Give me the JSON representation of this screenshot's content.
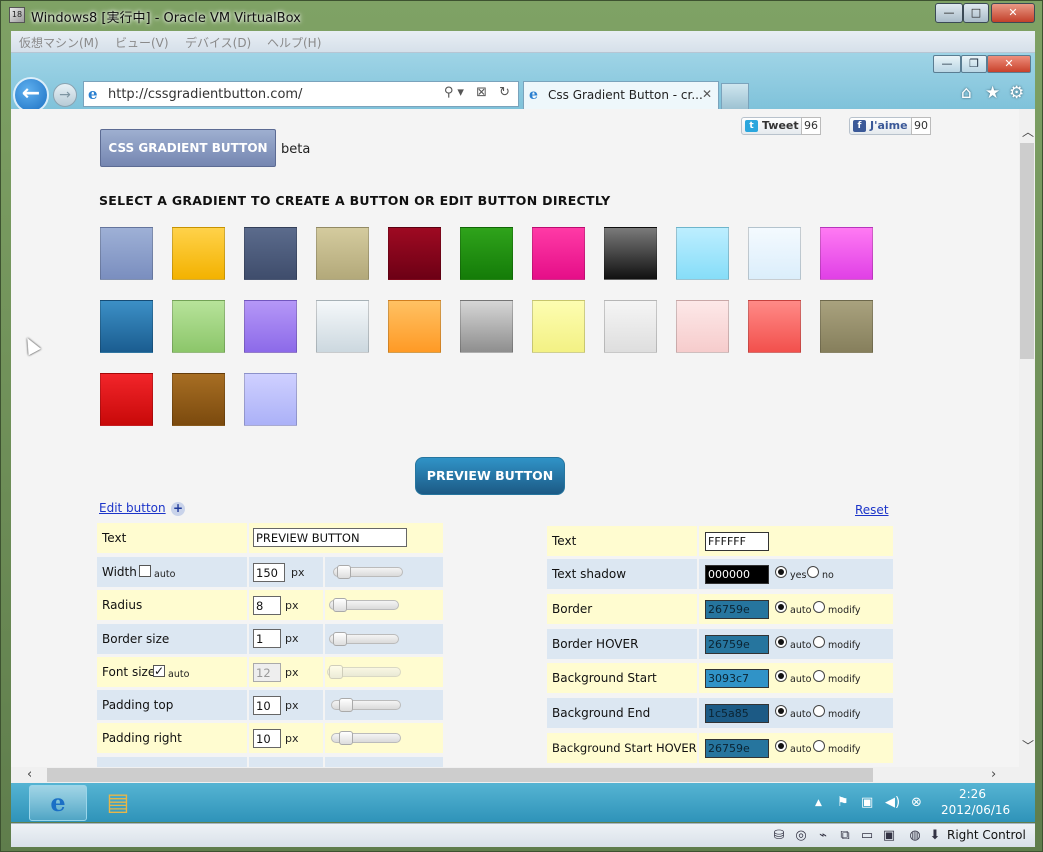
{
  "vbox": {
    "title": "Windows8 [実行中] - Oracle VM VirtualBox",
    "app_icon_text": "18",
    "controls": {
      "minimize": "—",
      "maximize": "□",
      "close": "✕"
    },
    "menu": [
      "仮想マシン(M)",
      "ビュー(V)",
      "デバイス(D)",
      "ヘルプ(H)"
    ],
    "status_host_key": "Right Control"
  },
  "ie": {
    "address": "http://cssgradientbutton.com/",
    "address_icons": "⚲▾ ⊠ ↻",
    "tab_label": "Css Gradient Button - cr...",
    "tab_close": "✕",
    "window_controls": {
      "minimize": "—",
      "restore": "❐",
      "close": "✕"
    },
    "right_icons": {
      "home": "⌂",
      "favorites": "★",
      "tools": "⚙"
    }
  },
  "page": {
    "logo_button": "CSS GRADIENT BUTTON",
    "logo_beta": "beta",
    "tweet": {
      "label": "Tweet",
      "count": "96"
    },
    "like": {
      "label": "J'aime",
      "count": "90"
    },
    "section_heading": "SELECT A GRADIENT TO CREATE A BUTTON OR EDIT BUTTON DIRECTLY",
    "swatches": [
      {
        "top": "#9eb0d6",
        "bottom": "#7a8ebf"
      },
      {
        "top": "#ffd24a",
        "bottom": "#f3b200"
      },
      {
        "top": "#5b6b8c",
        "bottom": "#3f4d6c"
      },
      {
        "top": "#d4cb9e",
        "bottom": "#b3a97a"
      },
      {
        "top": "#9e0a22",
        "bottom": "#6d0015"
      },
      {
        "top": "#2fa31b",
        "bottom": "#147c08"
      },
      {
        "top": "#ff3aa6",
        "bottom": "#e50e88"
      },
      {
        "top": "#7a7a7a",
        "bottom": "#111111"
      },
      {
        "top": "#bdeeff",
        "bottom": "#86ddf8"
      },
      {
        "top": "#f4faff",
        "bottom": "#dbeefb"
      },
      {
        "top": "#ff7af3",
        "bottom": "#e040e6"
      },
      {
        "top": "#3c90c6",
        "bottom": "#1a5d90"
      },
      {
        "top": "#b7e39a",
        "bottom": "#8cc66a"
      },
      {
        "top": "#b597f7",
        "bottom": "#8c6ae9"
      },
      {
        "top": "#f5f8fa",
        "bottom": "#ccd8df"
      },
      {
        "top": "#ffc163",
        "bottom": "#ff9a25"
      },
      {
        "top": "#d6d6d6",
        "bottom": "#8e8e8e"
      },
      {
        "top": "#fdfdb1",
        "bottom": "#f3f184"
      },
      {
        "top": "#f5f5f5",
        "bottom": "#dedede"
      },
      {
        "top": "#fde8e8",
        "bottom": "#f6cccc"
      },
      {
        "top": "#ff8a87",
        "bottom": "#f2504c"
      },
      {
        "top": "#a9a27e",
        "bottom": "#867f5c"
      },
      {
        "top": "#f2252a",
        "bottom": "#c80909"
      },
      {
        "top": "#a76e23",
        "bottom": "#7b4a0e"
      },
      {
        "top": "#cfd0ff",
        "bottom": "#abb1f7"
      }
    ],
    "preview_label": "PREVIEW BUTTON",
    "edit_link": "Edit button",
    "edit_plus": "+",
    "reset_link": "Reset",
    "left_rows": [
      {
        "label": "Text",
        "value": "PREVIEW BUTTON"
      },
      {
        "label": "Width",
        "value": "150",
        "unit": "px",
        "auto_label": "auto",
        "auto_checked": false,
        "slider": 0.05
      },
      {
        "label": "Radius",
        "value": "8",
        "unit": "px",
        "slider": 0.05
      },
      {
        "label": "Border size",
        "value": "1",
        "unit": "px",
        "slider": 0.05
      },
      {
        "label": "Font size",
        "value": "12",
        "unit": "px",
        "auto_label": "auto",
        "auto_checked": true,
        "slider": 0.02
      },
      {
        "label": "Padding top",
        "value": "10",
        "unit": "px",
        "slider": 0.12
      },
      {
        "label": "Padding right",
        "value": "10",
        "unit": "px",
        "slider": 0.12
      }
    ],
    "right_rows": [
      {
        "label": "Text",
        "value": "FFFFFF",
        "swatch": "#ffffff"
      },
      {
        "label": "Text shadow",
        "value": "000000",
        "swatch": "#000000",
        "opt1": "yes",
        "opt2": "no"
      },
      {
        "label": "Border",
        "value": "26759e",
        "swatch": "#26759e",
        "opt1": "auto",
        "opt2": "modify"
      },
      {
        "label": "Border HOVER",
        "value": "26759e",
        "swatch": "#26759e",
        "opt1": "auto",
        "opt2": "modify"
      },
      {
        "label": "Background Start",
        "value": "3093c7",
        "swatch": "#3093c7",
        "opt1": "auto",
        "opt2": "modify"
      },
      {
        "label": "Background End",
        "value": "1c5a85",
        "swatch": "#1c5a85",
        "opt1": "auto",
        "opt2": "modify"
      },
      {
        "label": "Background Start HOVER",
        "value": "26759e",
        "swatch": "#26759e",
        "opt1": "auto",
        "opt2": "modify"
      }
    ]
  },
  "taskbar": {
    "ie_icon": "e",
    "explorer_icon": "▤",
    "tray_icons": [
      "▲",
      "⚑",
      "▣",
      "◀)",
      "⊗"
    ],
    "time": "2:26",
    "date": "2012/06/16"
  }
}
